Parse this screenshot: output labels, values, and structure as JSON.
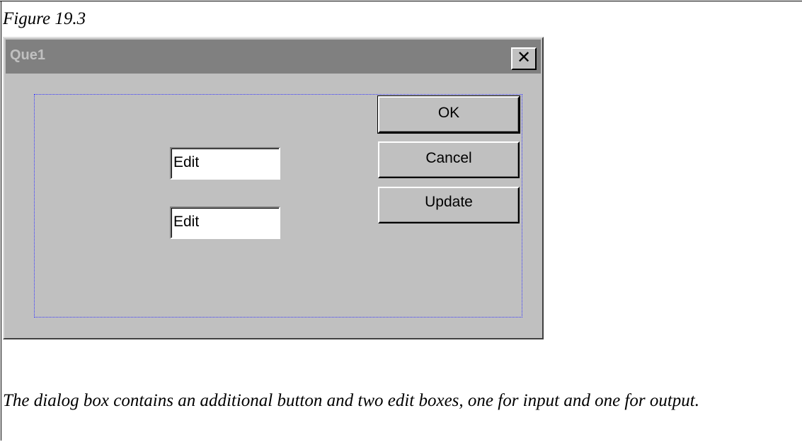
{
  "figure": {
    "title": "Figure 19.3"
  },
  "dialog": {
    "title": "Que1",
    "close_icon": "close-icon",
    "edit_boxes": [
      {
        "value": "Edit"
      },
      {
        "value": "Edit"
      }
    ],
    "buttons": {
      "ok": "OK",
      "cancel": "Cancel",
      "update": "Update"
    }
  },
  "caption": "The dialog box contains an additional button and two edit boxes, one for input and one for output.",
  "colors": {
    "dialog_bg": "#c0c0c0",
    "titlebar_bg": "#808080",
    "selection_border": "#3a3aff"
  }
}
